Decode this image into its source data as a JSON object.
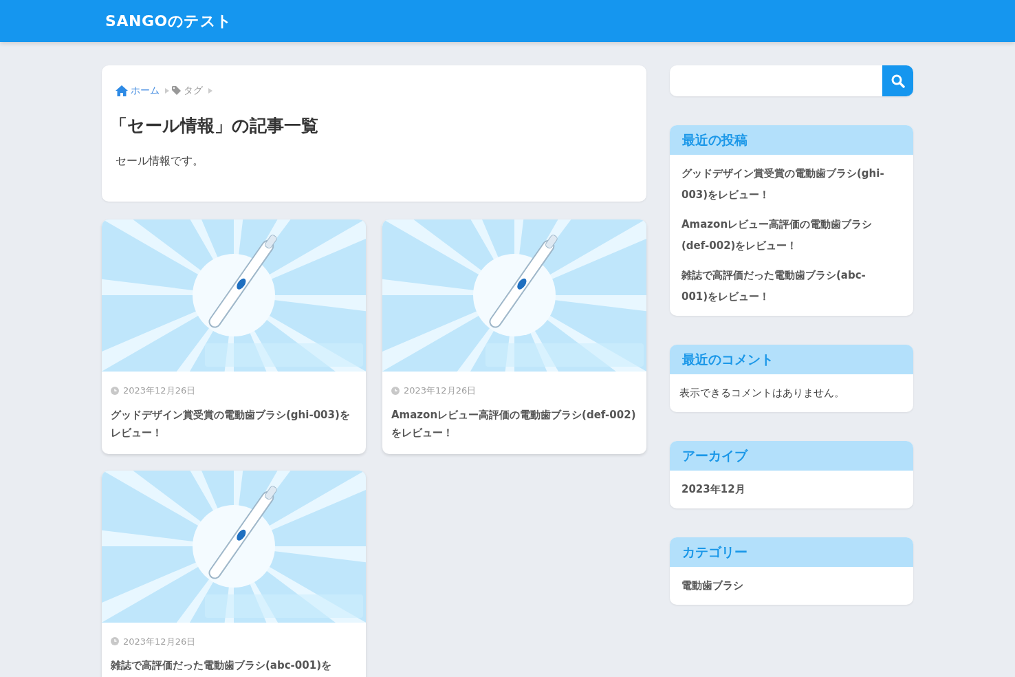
{
  "header": {
    "site_title": "SANGOのテスト"
  },
  "breadcrumb": [
    {
      "label": "ホーム",
      "kind": "home"
    },
    {
      "label": "タグ",
      "kind": "tag"
    }
  ],
  "archive_header": {
    "title": "「セール情報」の記事一覧",
    "description": "セール情報です。"
  },
  "posts": [
    {
      "date": "2023年12月26日",
      "title": "グッドデザイン賞受賞の電動歯ブラシ(ghi-003)をレビュー！"
    },
    {
      "date": "2023年12月26日",
      "title": "Amazonレビュー高評価の電動歯ブラシ(def-002)をレビュー！"
    },
    {
      "date": "2023年12月26日",
      "title": "雑誌で高評価だった電動歯ブラシ(abc-001)を"
    }
  ],
  "widgets": [
    {
      "title": "最近の投稿",
      "kind": "links",
      "items": [
        "グッドデザイン賞受賞の電動歯ブラシ(ghi-003)をレビュー！",
        "Amazonレビュー高評価の電動歯ブラシ(def-002)をレビュー！",
        "雑誌で高評価だった電動歯ブラシ(abc-001)をレビュー！"
      ]
    },
    {
      "title": "最近のコメント",
      "kind": "text",
      "items": [
        "表示できるコメントはありません。"
      ]
    },
    {
      "title": "アーカイブ",
      "kind": "links",
      "items": [
        "2023年12月"
      ]
    },
    {
      "title": "カテゴリー",
      "kind": "links",
      "items": [
        "電動歯ブラシ"
      ]
    }
  ]
}
